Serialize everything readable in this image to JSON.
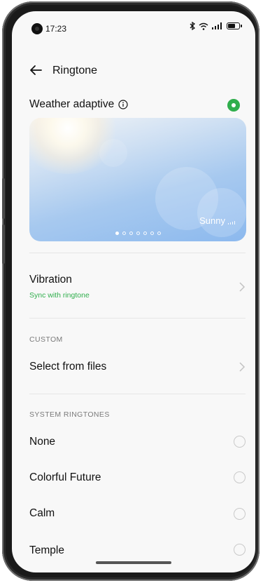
{
  "status": {
    "time": "17:23",
    "bluetooth_icon": "bluetooth-icon",
    "wifi_icon": "wifi-icon",
    "signal_icon": "signal-icon",
    "battery_icon": "battery-icon"
  },
  "header": {
    "title": "Ringtone",
    "back_icon": "back-arrow-icon"
  },
  "weather": {
    "label": "Weather adaptive",
    "info_icon": "info-icon",
    "enabled": true,
    "toggle_color": "#2fae4c",
    "card_label": "Sunny",
    "page_count": 7,
    "active_page": 1
  },
  "vibration": {
    "label": "Vibration",
    "sublabel": "Sync with ringtone",
    "sublabel_color": "#2fae4c"
  },
  "custom": {
    "section_title": "CUSTOM",
    "select_files_label": "Select from files"
  },
  "system": {
    "section_title": "SYSTEM RINGTONES",
    "ringtones": [
      {
        "label": "None",
        "selected": false
      },
      {
        "label": "Colorful Future",
        "selected": false
      },
      {
        "label": "Calm",
        "selected": false
      },
      {
        "label": "Temple",
        "selected": false
      }
    ]
  }
}
